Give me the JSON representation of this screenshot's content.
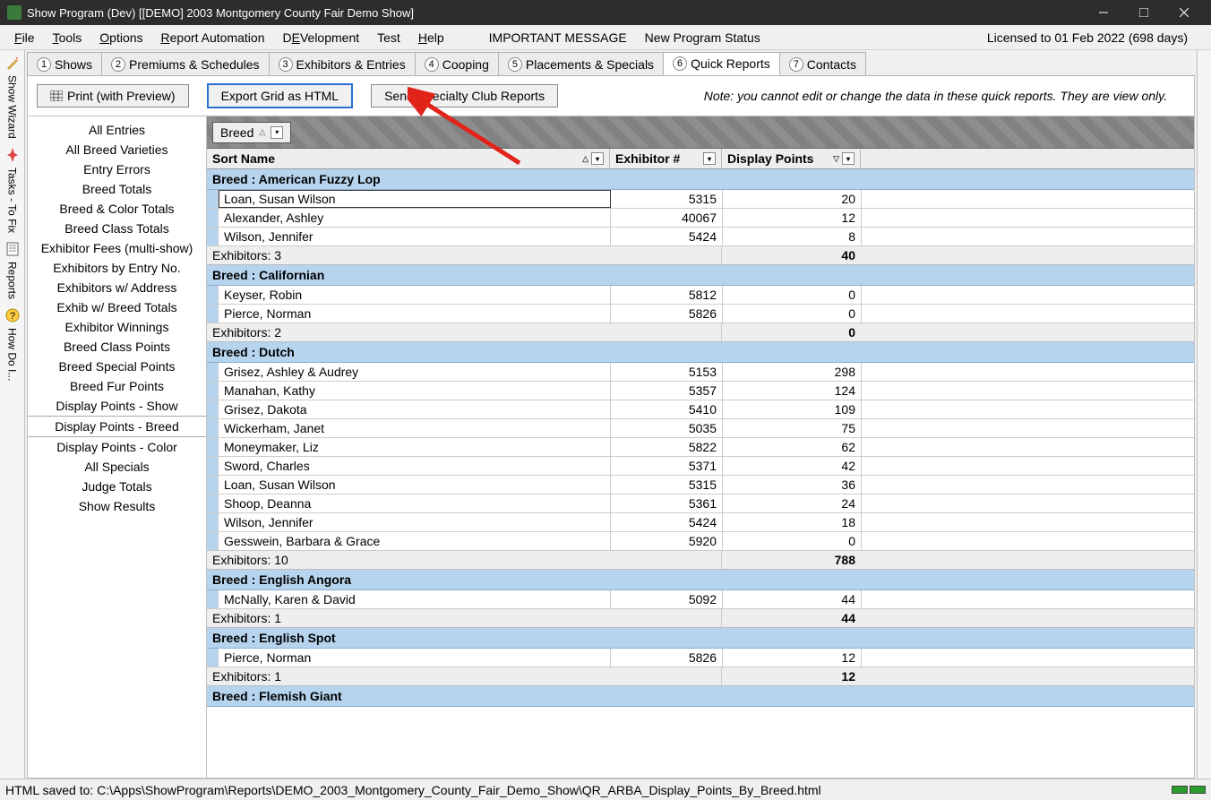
{
  "window": {
    "title": "Show Program (Dev) [[DEMO] 2003 Montgomery County Fair Demo Show]"
  },
  "menu": {
    "items": [
      "File",
      "Tools",
      "Options",
      "Report Automation",
      "DEVelopment",
      "Test",
      "Help"
    ],
    "important": "IMPORTANT MESSAGE",
    "newStatus": "New Program Status",
    "license": "Licensed to 01 Feb 2022 (698 days)"
  },
  "tabs": [
    {
      "num": "1",
      "label": "Shows"
    },
    {
      "num": "2",
      "label": "Premiums & Schedules"
    },
    {
      "num": "3",
      "label": "Exhibitors & Entries"
    },
    {
      "num": "4",
      "label": "Cooping"
    },
    {
      "num": "5",
      "label": "Placements & Specials"
    },
    {
      "num": "6",
      "label": "Quick Reports"
    },
    {
      "num": "7",
      "label": "Contacts"
    }
  ],
  "activeTab": 5,
  "toolbar": {
    "print": "Print (with Preview)",
    "export": "Export Grid as HTML",
    "send": "Send Specialty Club Reports",
    "note": "Note: you cannot edit or change the data in these quick reports. They are view only."
  },
  "reports": [
    "All Entries",
    "All Breed Varieties",
    "Entry Errors",
    "Breed Totals",
    "Breed & Color Totals",
    "Breed Class Totals",
    "Exhibitor Fees (multi-show)",
    "Exhibitors by Entry No.",
    "Exhibitors w/ Address",
    "Exhib w/ Breed Totals",
    "Exhibitor Winnings",
    "Breed Class Points",
    "Breed Special Points",
    "Breed Fur Points",
    "Display Points - Show",
    "Display Points - Breed",
    "Display Points - Color",
    "All Specials",
    "Judge Totals",
    "Show Results"
  ],
  "selectedReport": 15,
  "grid": {
    "groupBy": "Breed",
    "columns": {
      "sortName": "Sort Name",
      "exhibitorNum": "Exhibitor #",
      "displayPoints": "Display Points"
    },
    "groups": [
      {
        "title": "Breed : American Fuzzy Lop",
        "rows": [
          {
            "name": "Loan, Susan Wilson",
            "exnum": "5315",
            "points": "20",
            "selected": true
          },
          {
            "name": "Alexander, Ashley",
            "exnum": "40067",
            "points": "12"
          },
          {
            "name": "Wilson, Jennifer",
            "exnum": "5424",
            "points": "8"
          }
        ],
        "summary": {
          "label": "Exhibitors: 3",
          "total": "40"
        }
      },
      {
        "title": "Breed : Californian",
        "rows": [
          {
            "name": "Keyser, Robin",
            "exnum": "5812",
            "points": "0"
          },
          {
            "name": "Pierce, Norman",
            "exnum": "5826",
            "points": "0"
          }
        ],
        "summary": {
          "label": "Exhibitors: 2",
          "total": "0"
        }
      },
      {
        "title": "Breed : Dutch",
        "rows": [
          {
            "name": "Grisez, Ashley & Audrey",
            "exnum": "5153",
            "points": "298"
          },
          {
            "name": "Manahan, Kathy",
            "exnum": "5357",
            "points": "124"
          },
          {
            "name": "Grisez, Dakota",
            "exnum": "5410",
            "points": "109"
          },
          {
            "name": "Wickerham, Janet",
            "exnum": "5035",
            "points": "75"
          },
          {
            "name": "Moneymaker, Liz",
            "exnum": "5822",
            "points": "62"
          },
          {
            "name": "Sword, Charles",
            "exnum": "5371",
            "points": "42"
          },
          {
            "name": "Loan, Susan Wilson",
            "exnum": "5315",
            "points": "36"
          },
          {
            "name": "Shoop, Deanna",
            "exnum": "5361",
            "points": "24"
          },
          {
            "name": "Wilson, Jennifer",
            "exnum": "5424",
            "points": "18"
          },
          {
            "name": "Gesswein, Barbara & Grace",
            "exnum": "5920",
            "points": "0"
          }
        ],
        "summary": {
          "label": "Exhibitors: 10",
          "total": "788"
        }
      },
      {
        "title": "Breed : English Angora",
        "rows": [
          {
            "name": "McNally, Karen & David",
            "exnum": "5092",
            "points": "44"
          }
        ],
        "summary": {
          "label": "Exhibitors: 1",
          "total": "44"
        }
      },
      {
        "title": "Breed : English Spot",
        "rows": [
          {
            "name": "Pierce, Norman",
            "exnum": "5826",
            "points": "12"
          }
        ],
        "summary": {
          "label": "Exhibitors: 1",
          "total": "12"
        }
      },
      {
        "title": "Breed : Flemish Giant",
        "rows": [],
        "summary": null
      }
    ]
  },
  "status": {
    "text": "HTML saved to: C:\\Apps\\ShowProgram\\Reports\\DEMO_2003_Montgomery_County_Fair_Demo_Show\\QR_ARBA_Display_Points_By_Breed.html"
  },
  "leftToolbar": {
    "wizard": "Show Wizard",
    "tasks": "Tasks - To Fix",
    "reports": "Reports",
    "help": "How Do I..."
  }
}
